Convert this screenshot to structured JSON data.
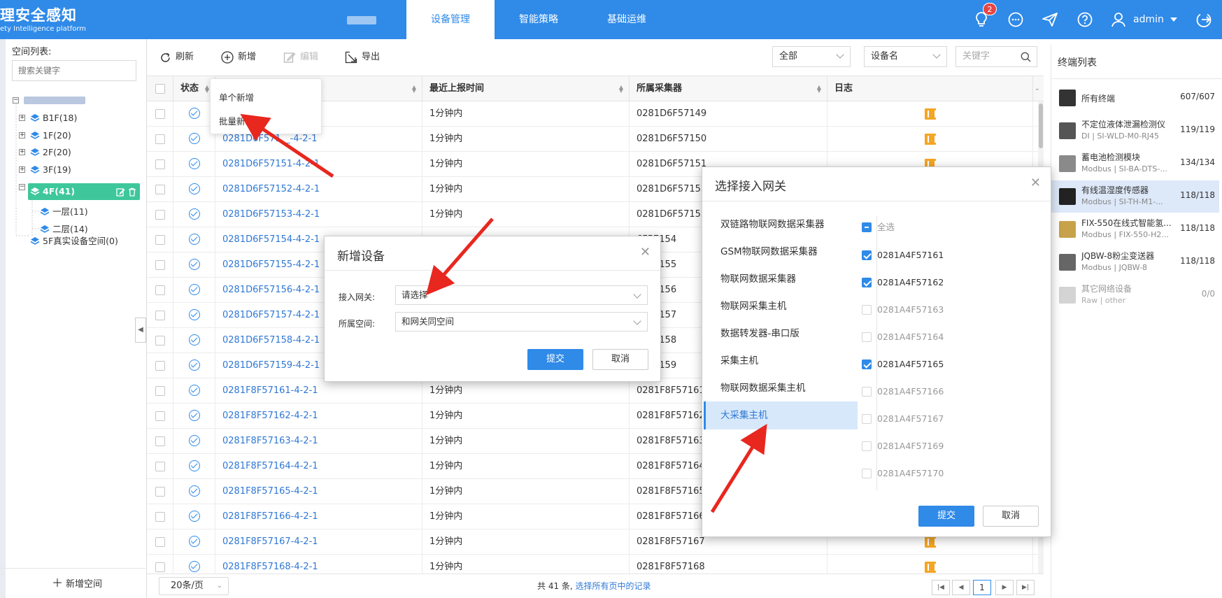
{
  "header": {
    "brand_title": "理安全感知",
    "brand_subtitle": "ety Intelligence platform",
    "nav_tabs": [
      {
        "label": "设备管理"
      },
      {
        "label": "智能策略"
      },
      {
        "label": "基础运维"
      }
    ],
    "notification_count": "2",
    "user_name": "admin"
  },
  "space_panel": {
    "title": "空间列表:",
    "search_placeholder": "搜索关键字",
    "tree": [
      {
        "label": "B1F(18)"
      },
      {
        "label": "1F(20)"
      },
      {
        "label": "2F(20)"
      },
      {
        "label": "3F(19)"
      },
      {
        "label": "4F(41)"
      },
      {
        "label": "一层(11)"
      },
      {
        "label": "二层(14)"
      },
      {
        "label": "5F真实设备空间(0)"
      }
    ],
    "add_space_label": "新增空间"
  },
  "toolbar": {
    "refresh_label": "刷新",
    "add_label": "新增",
    "edit_label": "编辑",
    "export_label": "导出",
    "filter_scope": "全部",
    "filter_field": "设备名",
    "keyword_placeholder": "关键字"
  },
  "add_menu": {
    "items": [
      {
        "label": "单个新增"
      },
      {
        "label": "批量新增"
      }
    ]
  },
  "table": {
    "columns": [
      {
        "label": "状态"
      },
      {
        "label": "最近上报时间"
      },
      {
        "label": "所属采集器"
      },
      {
        "label": "日志"
      }
    ],
    "rows": [
      {
        "device": "",
        "report_time": "1分钟内",
        "collector": "0281D6F57149"
      },
      {
        "device": "0281D6F571__-4-2-1",
        "report_time": "1分钟内",
        "collector": "0281D6F57150"
      },
      {
        "device": "0281D6F57151-4-2-1",
        "report_time": "1分钟内",
        "collector": "0281D6F57151"
      },
      {
        "device": "0281D6F57152-4-2-1",
        "report_time": "1分钟内",
        "collector": "0281D6F57152"
      },
      {
        "device": "0281D6F57153-4-2-1",
        "report_time": "1分钟内",
        "collector": "0281D6F57153"
      },
      {
        "device": "0281D6F57154-4-2-1",
        "report_time": "",
        "collector": "6F57154"
      },
      {
        "device": "0281D6F57155-4-2-1",
        "report_time": "",
        "collector": "6F57155"
      },
      {
        "device": "0281D6F57156-4-2-1",
        "report_time": "",
        "collector": "6F57156"
      },
      {
        "device": "0281D6F57157-4-2-1",
        "report_time": "",
        "collector": "6F57157"
      },
      {
        "device": "0281D6F57158-4-2-1",
        "report_time": "",
        "collector": "6F57158"
      },
      {
        "device": "0281D6F57159-4-2-1",
        "report_time": "",
        "collector": "6F57159"
      },
      {
        "device": "0281F8F57161-4-2-1",
        "report_time": "1分钟内",
        "collector": "0281F8F57161"
      },
      {
        "device": "0281F8F57162-4-2-1",
        "report_time": "1分钟内",
        "collector": "0281F8F57162"
      },
      {
        "device": "0281F8F57163-4-2-1",
        "report_time": "1分钟内",
        "collector": "0281F8F57163"
      },
      {
        "device": "0281F8F57164-4-2-1",
        "report_time": "1分钟内",
        "collector": "0281F8F57164"
      },
      {
        "device": "0281F8F57165-4-2-1",
        "report_time": "1分钟内",
        "collector": "0281F8F57165"
      },
      {
        "device": "0281F8F57166-4-2-1",
        "report_time": "1分钟内",
        "collector": "0281F8F57166"
      },
      {
        "device": "0281F8F57167-4-2-1",
        "report_time": "1分钟内",
        "collector": "0281F8F57167"
      },
      {
        "device": "0281F8F57168-4-2-1",
        "report_time": "1分钟内",
        "collector": "0281F8F57168"
      }
    ]
  },
  "pagination": {
    "page_size": "20条/页",
    "summary_prefix": "共 41 条,",
    "select_all_pages": "选择所有页中的记录",
    "current_page": "1"
  },
  "terminal_panel": {
    "title": "终端列表",
    "items": [
      {
        "name": "所有终端",
        "sub": "",
        "count": "607/607"
      },
      {
        "name": "不定位液体泄漏检测仪",
        "sub": "DI | SI-WLD-M0-RJ45",
        "count": "119/119"
      },
      {
        "name": "蓄电池检测模块",
        "sub": "Modbus | SI-BA-DTS-...",
        "count": "134/134"
      },
      {
        "name": "有线温湿度传感器",
        "sub": "Modbus | SI-TH-M1-...",
        "count": "118/118"
      },
      {
        "name": "FIX-550在线式智能氢...",
        "sub": "Modbus | FIX-550-H2...",
        "count": "118/118"
      },
      {
        "name": "JQBW-8粉尘变送器",
        "sub": "Modbus | JQBW-8",
        "count": "118/118"
      },
      {
        "name": "其它网络设备",
        "sub": "Raw | other",
        "count": "0/0"
      }
    ]
  },
  "add_device_modal": {
    "title": "新增设备",
    "gateway_label": "接入网关:",
    "gateway_value": "请选择",
    "space_label": "所属空间:",
    "space_value": "和网关同空间",
    "submit_label": "提交",
    "cancel_label": "取消"
  },
  "gateway_modal": {
    "title": "选择接入网关",
    "types": [
      {
        "label": "双链路物联网数据采集器"
      },
      {
        "label": "GSM物联网数据采集器"
      },
      {
        "label": "物联网数据采集器"
      },
      {
        "label": "物联网采集主机"
      },
      {
        "label": "数据转发器-串口版"
      },
      {
        "label": "采集主机"
      },
      {
        "label": "物联网数据采集主机"
      },
      {
        "label": "大采集主机"
      }
    ],
    "select_all_label": "全选",
    "gateways": [
      {
        "label": "0281A4F57161",
        "checked": true
      },
      {
        "label": "0281A4F57162",
        "checked": true
      },
      {
        "label": "0281A4F57163",
        "checked": false
      },
      {
        "label": "0281A4F57164",
        "checked": false
      },
      {
        "label": "0281A4F57165",
        "checked": true
      },
      {
        "label": "0281A4F57166",
        "checked": false
      },
      {
        "label": "0281A4F57167",
        "checked": false
      },
      {
        "label": "0281A4F57169",
        "checked": false
      },
      {
        "label": "0281A4F57170",
        "checked": false
      }
    ],
    "submit_label": "提交",
    "cancel_label": "取消"
  },
  "colors": {
    "primary": "#2f8ae8",
    "tree_active": "#3ec79a",
    "log_icon": "#f5a623",
    "annotation_arrow": "#e8271f"
  }
}
